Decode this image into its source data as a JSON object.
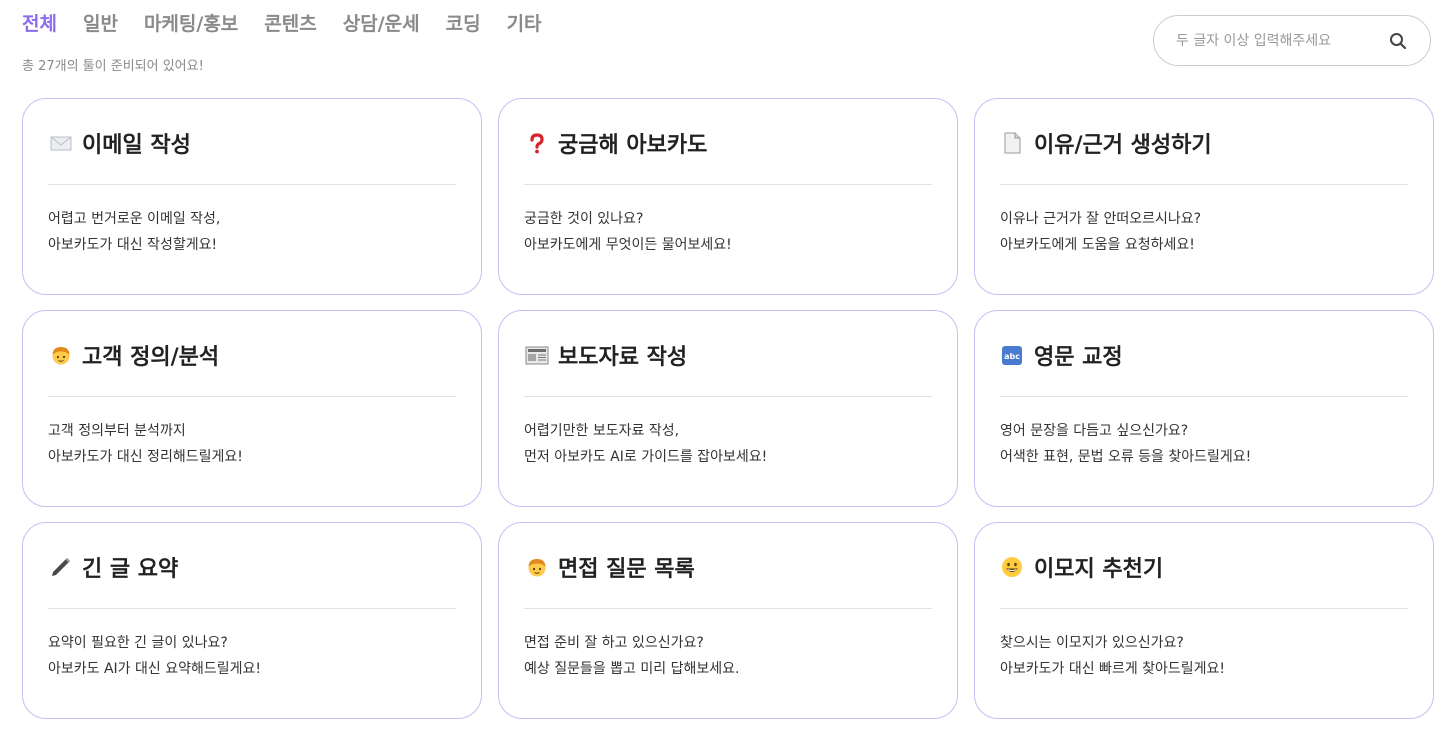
{
  "tabs": [
    {
      "label": "전체",
      "active": true
    },
    {
      "label": "일반",
      "active": false
    },
    {
      "label": "마케팅/홍보",
      "active": false
    },
    {
      "label": "콘텐츠",
      "active": false
    },
    {
      "label": "상담/운세",
      "active": false
    },
    {
      "label": "코딩",
      "active": false
    },
    {
      "label": "기타",
      "active": false
    }
  ],
  "tool_count_text": "총 27개의 툴이 준비되어 있어요!",
  "search": {
    "placeholder": "두 글자 이상 입력해주세요",
    "value": ""
  },
  "accent_color": "#8b6cf0",
  "card_border_color": "#c7bff5",
  "cards": [
    {
      "icon": "envelope-icon",
      "title": "이메일 작성",
      "desc": [
        "어렵고 번거로운 이메일 작성,",
        "아보카도가 대신 작성할게요!"
      ]
    },
    {
      "icon": "question-mark-icon",
      "title": "궁금해 아보카도",
      "desc": [
        "궁금한 것이 있나요?",
        "아보카도에게 무엇이든 물어보세요!"
      ]
    },
    {
      "icon": "document-icon",
      "title": "이유/근거 생성하기",
      "desc": [
        "이유나 근거가 잘 안떠오르시나요?",
        "아보카도에게 도움을 요청하세요!"
      ]
    },
    {
      "icon": "person-icon",
      "title": "고객 정의/분석",
      "desc": [
        "고객 정의부터 분석까지",
        "아보카도가 대신 정리해드릴게요!"
      ]
    },
    {
      "icon": "newspaper-icon",
      "title": "보도자료 작성",
      "desc": [
        "어렵기만한 보도자료 작성,",
        "먼저 아보카도 AI로 가이드를 잡아보세요!"
      ]
    },
    {
      "icon": "abc-icon",
      "title": "영문 교정",
      "desc": [
        "영어 문장을 다듬고 싶으신가요?",
        "어색한 표현, 문법 오류 등을 찾아드릴게요!"
      ]
    },
    {
      "icon": "pen-icon",
      "title": "긴 글 요약",
      "desc": [
        "요약이 필요한 긴 글이 있나요?",
        "아보카도 AI가 대신 요약해드릴게요!"
      ]
    },
    {
      "icon": "person-icon",
      "title": "면접 질문 목록",
      "desc": [
        "면접 준비 잘 하고 있으신가요?",
        "예상 질문들을 뽑고 미리 답해보세요."
      ]
    },
    {
      "icon": "smiley-icon",
      "title": "이모지 추천기",
      "desc": [
        "찾으시는 이모지가 있으신가요?",
        "아보카도가 대신 빠르게 찾아드릴게요!"
      ]
    }
  ]
}
